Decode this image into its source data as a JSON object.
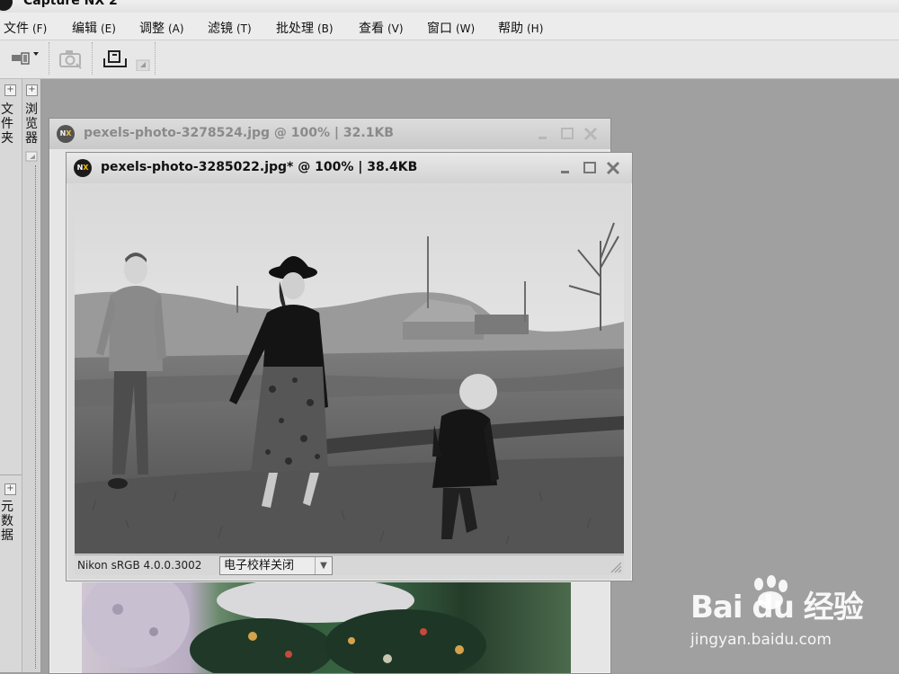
{
  "app": {
    "title": "Capture NX 2"
  },
  "menu": [
    {
      "label": "文件",
      "accel": "(F)"
    },
    {
      "label": "编辑",
      "accel": "(E)"
    },
    {
      "label": "调整",
      "accel": "(A)"
    },
    {
      "label": "滤镜",
      "accel": "(T)"
    },
    {
      "label": "批处理",
      "accel": "(B)"
    },
    {
      "label": "查看",
      "accel": "(V)"
    },
    {
      "label": "窗口",
      "accel": "(W)"
    },
    {
      "label": "帮助",
      "accel": "(H)"
    }
  ],
  "toolbar": {
    "icons": [
      "browser-layout-icon",
      "camera-icon",
      "print-icon"
    ]
  },
  "dock": {
    "folders_label": "文件夹",
    "browser_label": "浏览器",
    "metadata_label": "元数据"
  },
  "windows": {
    "back": {
      "title": "pexels-photo-3278524.jpg @ 100% | 32.1KB"
    },
    "front": {
      "title": "pexels-photo-3285022.jpg* @ 100% | 38.4KB",
      "profile": "Nikon sRGB 4.0.0.3002",
      "softproof_value": "电子校样关闭"
    }
  },
  "watermark": {
    "brand": "Bai du 经验",
    "url": "jingyan.baidu.com"
  },
  "colors": {
    "workspace": "#a0a0a0",
    "menubar": "#ececec",
    "logo_accent": "#f2c200"
  }
}
